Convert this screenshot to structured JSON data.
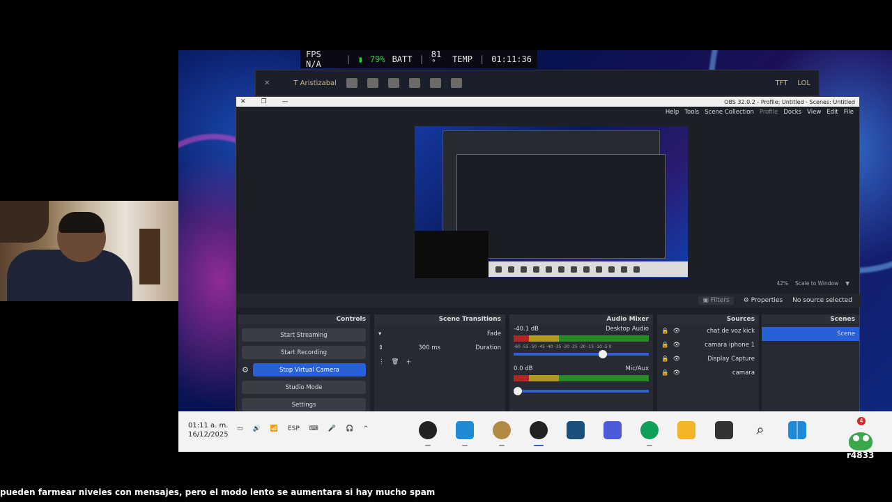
{
  "hud": {
    "time": "01:11:36",
    "temp_label": "TEMP",
    "temp_value": "81 ̊",
    "batt_label": "BATT",
    "batt_value": "79%",
    "fps": "FPS N/A"
  },
  "obs": {
    "title": "OBS 32.0.2 - Profile: Untitled - Scenes: Untitled",
    "menu": [
      "File",
      "Edit",
      "View",
      "Docks",
      "Profile",
      "Scene Collection",
      "Tools",
      "Help"
    ],
    "preview_scale": "Scale to Window",
    "preview_zoom": "42%",
    "no_source": "No source selected",
    "properties_label": "Properties",
    "filters_label": "Filters",
    "scenes": {
      "title": "Scenes",
      "items": [
        "Scene"
      ]
    },
    "sources": {
      "title": "Sources",
      "items": [
        "chat de voz kick",
        "camara iphone 1",
        "Display Capture",
        "camara"
      ]
    },
    "mixer": {
      "title": "Audio Mixer",
      "channels": [
        {
          "name": "Desktop Audio",
          "db": "-40.1 dB"
        },
        {
          "name": "Mic/Aux",
          "db": "0.0 dB"
        }
      ],
      "scale": "-60 -55 -50 -45 -40 -35 -30 -25 -20 -15 -10 -5 0"
    },
    "transitions": {
      "title": "Scene Transitions",
      "type": "Fade",
      "duration_label": "Duration",
      "duration_value": "300 ms"
    },
    "controls": {
      "title": "Controls",
      "buttons": [
        "Start Streaming",
        "Start Recording",
        "Stop Virtual Camera",
        "Studio Mode",
        "Settings"
      ]
    }
  },
  "client": {
    "items": [
      "LOL",
      "TFT"
    ],
    "user": "T Aristizabal"
  },
  "taskbar": {
    "clock_time": "01:11 a. m.",
    "clock_date": "16/12/2025",
    "lang": "ESP"
  },
  "caption": "pueden farmear niveles con mensajes, pero el modo lento se aumentara si hay mucho spam",
  "badge": {
    "count": "4",
    "label": "r4833"
  },
  "colors": {
    "accent": "#2860d8",
    "batt": "#2ecc40"
  }
}
